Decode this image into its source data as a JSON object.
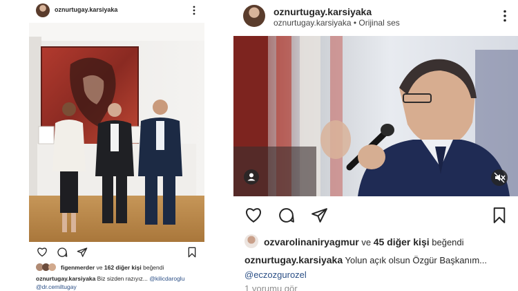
{
  "left_post": {
    "username": "oznurtugay.karsiyaka",
    "more_icon": "more-vertical-icon",
    "liked_by_user": "figenmerder",
    "likes_connector": "ve",
    "likes_others": "162 diğer kişi",
    "likes_suffix": "beğendi",
    "caption_user": "oznurtugay.karsiyaka",
    "caption_text": "Biz sizden razıyız...",
    "mention_1": "@kilicdaroglu",
    "mention_2": "@dr.cemiltugay"
  },
  "right_post": {
    "username": "oznurtugay.karsiyaka",
    "audio_user": "oznurtugay.karsiyaka",
    "audio_sep": "•",
    "audio_label": "Orijinal ses",
    "liked_by_user": "ozvarolinaniryagmur",
    "likes_connector": "ve",
    "likes_others": "45 diğer kişi",
    "likes_suffix": "beğendi",
    "caption_user": "oznurtugay.karsiyaka",
    "caption_text": "Yolun açık olsun Özgür Başkanım...",
    "mention_1": "@eczozgurozel",
    "comments_link": "1 yorumu gör"
  },
  "colors": {
    "link": "#2b4f86",
    "muted": "#8e8e8e",
    "text": "#262626"
  }
}
